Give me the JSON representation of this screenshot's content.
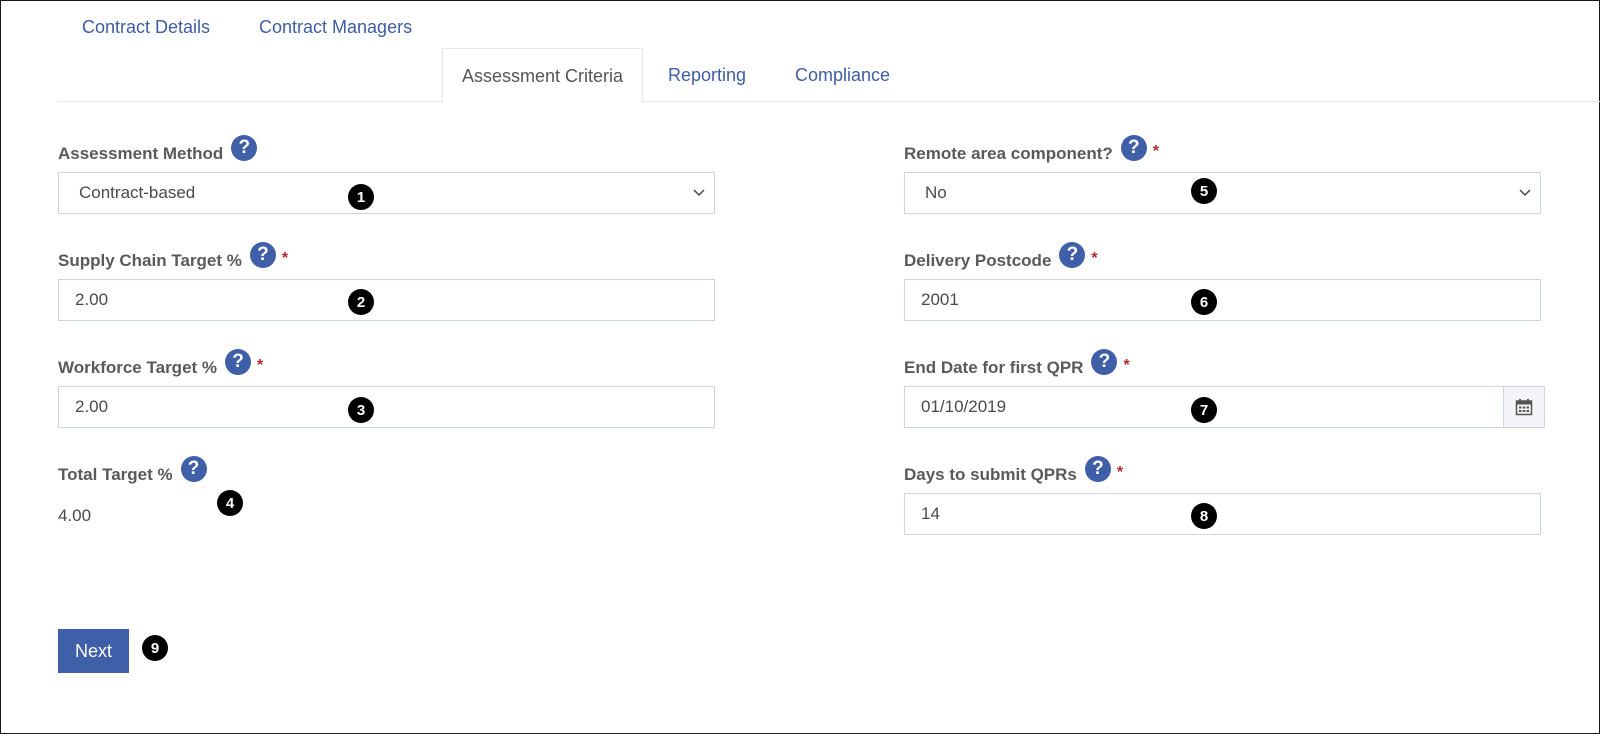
{
  "tabs": [
    {
      "label": "Contract Details",
      "active": false
    },
    {
      "label": "Contract Managers",
      "active": false
    },
    {
      "label": "Assessment Criteria",
      "active": true
    },
    {
      "label": "Reporting",
      "active": false
    },
    {
      "label": "Compliance",
      "active": false
    }
  ],
  "help_glyph": "?",
  "required_mark": "*",
  "left": {
    "assessment_method": {
      "label": "Assessment Method",
      "value": "Contract-based"
    },
    "supply_chain_target": {
      "label": "Supply Chain Target %",
      "value": "2.00"
    },
    "workforce_target": {
      "label": "Workforce Target %",
      "value": "2.00"
    },
    "total_target": {
      "label": "Total Target %",
      "value": "4.00"
    }
  },
  "right": {
    "remote_area": {
      "label": "Remote area component?",
      "value": "No"
    },
    "delivery_postcode": {
      "label": "Delivery Postcode",
      "value": "2001"
    },
    "end_date_qpr": {
      "label": "End Date for first QPR",
      "value": "01/10/2019"
    },
    "days_submit_qprs": {
      "label": "Days to submit QPRs",
      "value": "14"
    }
  },
  "next_button": {
    "label": "Next"
  },
  "markers": [
    "1",
    "2",
    "3",
    "4",
    "5",
    "6",
    "7",
    "8",
    "9"
  ],
  "colors": {
    "accent": "#3f5fa8",
    "required": "#b02a2a",
    "tab_text": "#3e5da6"
  }
}
